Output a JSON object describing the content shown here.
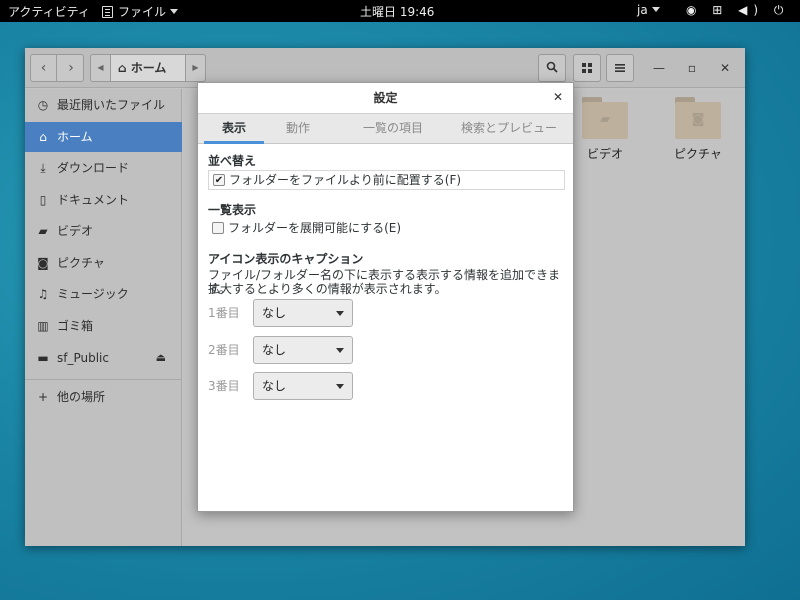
{
  "topbar": {
    "activities": "アクティビティ",
    "app_menu": "ファイル",
    "clock": "土曜日 19:46",
    "lang": "ja",
    "system_icons": "◉ ⊞ ◀) ⏻"
  },
  "headerbar": {
    "path_home": "ホーム"
  },
  "sidebar": {
    "items": [
      {
        "label": "最近開いたファイル",
        "icon": "clock-icon"
      },
      {
        "label": "ホーム",
        "icon": "home-icon"
      },
      {
        "label": "ダウンロード",
        "icon": "download-icon"
      },
      {
        "label": "ドキュメント",
        "icon": "document-icon"
      },
      {
        "label": "ビデオ",
        "icon": "video-icon"
      },
      {
        "label": "ピクチャ",
        "icon": "camera-icon"
      },
      {
        "label": "ミュージック",
        "icon": "music-icon"
      },
      {
        "label": "ゴミ箱",
        "icon": "trash-icon"
      },
      {
        "label": "sf_Public",
        "icon": "drive-icon"
      },
      {
        "label": "他の場所",
        "icon": "plus-icon"
      }
    ]
  },
  "main": {
    "folders": [
      {
        "label": "ビデオ",
        "icon": "video-folder-icon"
      },
      {
        "label": "ピクチャ",
        "icon": "picture-folder-icon"
      }
    ]
  },
  "dialog": {
    "title": "設定",
    "tabs": [
      "表示",
      "動作",
      "一覧の項目",
      "検索とプレビュー"
    ],
    "sort": {
      "heading": "並べ替え",
      "option": "フォルダーをファイルより前に配置する(F)",
      "checked": true
    },
    "list": {
      "heading": "一覧表示",
      "option": "フォルダーを展開可能にする(E)",
      "checked": false
    },
    "captions": {
      "heading": "アイコン表示のキャプション",
      "desc1": "ファイル/フォルダー名の下に表示する表示する情報を追加できます。",
      "desc2": "拡大するとより多くの情報が表示されます。",
      "rows": [
        {
          "rank": "1番目",
          "value": "なし"
        },
        {
          "rank": "2番目",
          "value": "なし"
        },
        {
          "rank": "3番目",
          "value": "なし"
        }
      ]
    }
  }
}
